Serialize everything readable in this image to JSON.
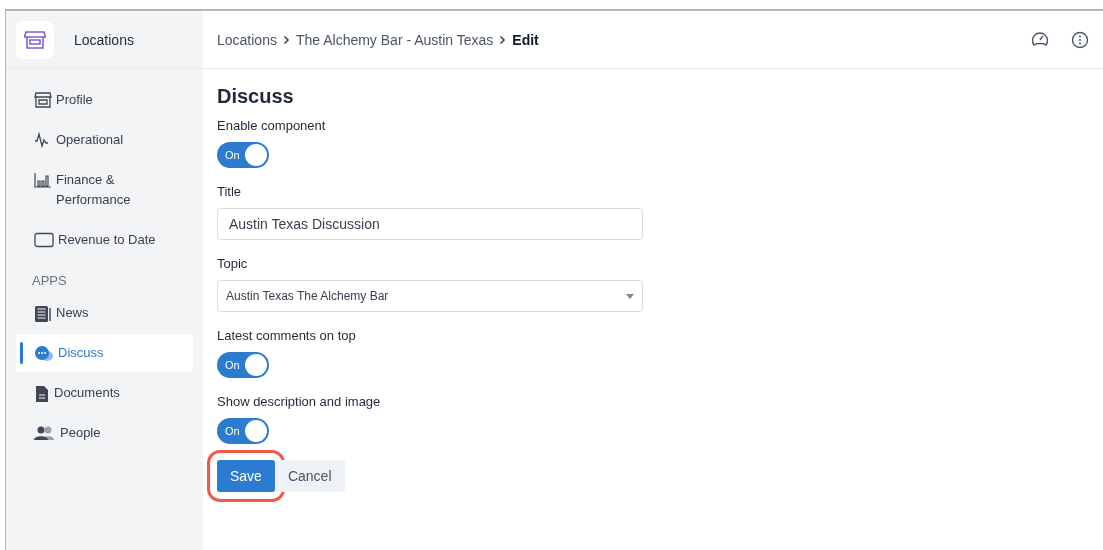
{
  "app": {
    "title": "Locations"
  },
  "breadcrumb": [
    {
      "label": "Locations",
      "current": false
    },
    {
      "label": "The Alchemy Bar - Austin Texas",
      "current": false
    },
    {
      "label": "Edit",
      "current": true
    }
  ],
  "sidebar": {
    "items": [
      {
        "label": "Profile",
        "selected": false
      },
      {
        "label": "Operational",
        "selected": false
      },
      {
        "label": "Finance & Performance",
        "selected": false
      },
      {
        "label": "Revenue to Date",
        "selected": false
      }
    ],
    "apps_heading": "APPS",
    "apps": [
      {
        "label": "News",
        "selected": false
      },
      {
        "label": "Discuss",
        "selected": true
      },
      {
        "label": "Documents",
        "selected": false
      },
      {
        "label": "People",
        "selected": false
      }
    ]
  },
  "form": {
    "heading": "Discuss",
    "fields": [
      {
        "kind": "toggle",
        "label": "Enable component",
        "on": true,
        "text": "On"
      },
      {
        "kind": "text",
        "label": "Title",
        "value": "Austin Texas Discussion"
      },
      {
        "kind": "select",
        "label": "Topic",
        "value": "Austin Texas The Alchemy Bar"
      },
      {
        "kind": "toggle",
        "label": "Latest comments on top",
        "on": true,
        "text": "On"
      },
      {
        "kind": "toggle",
        "label": "Show description and image",
        "on": true,
        "text": "On"
      }
    ],
    "buttons": [
      {
        "label": "Save",
        "kind": "primary",
        "highlighted": true
      },
      {
        "label": "Cancel",
        "kind": "secondary",
        "highlighted": false
      }
    ]
  }
}
